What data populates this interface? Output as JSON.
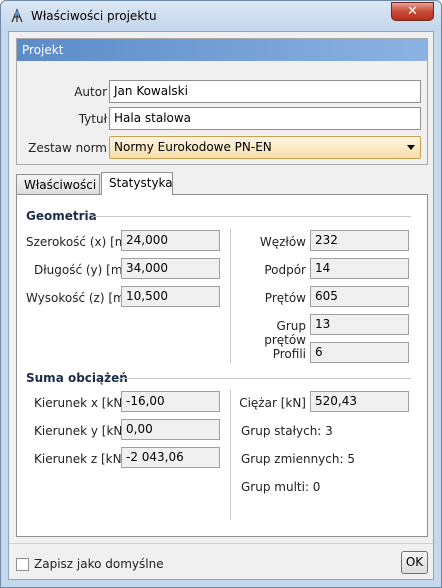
{
  "window": {
    "title": "Właściwości projektu",
    "close_label": "✕"
  },
  "project": {
    "header": "Projekt",
    "author_label": "Autor",
    "author_value": "Jan Kowalski",
    "title_label": "Tytuł",
    "title_value": "Hala stalowa",
    "norms_label": "Zestaw norm",
    "norms_value": "Normy Eurokodowe PN-EN"
  },
  "tabs": [
    {
      "label": "Właściwości"
    },
    {
      "label": "Statystyka"
    }
  ],
  "geometry": {
    "header": "Geometria",
    "width_label": "Szerokość (x) [m]",
    "width_value": "24,000",
    "length_label": "Długość (y) [m]",
    "length_value": "34,000",
    "height_label": "Wysokość (z) [m]",
    "height_value": "10,500",
    "nodes_label": "Węzłów",
    "nodes_value": "232",
    "supports_label": "Podpór",
    "supports_value": "14",
    "bars_label": "Prętów",
    "bars_value": "605",
    "bargroups_label": "Grup prętów",
    "bargroups_value": "13",
    "profiles_label": "Profili",
    "profiles_value": "6"
  },
  "loads": {
    "header": "Suma obciążeń",
    "dirx_label": "Kierunek x [kN]",
    "dirx_value": "-16,00",
    "diry_label": "Kierunek y [kN]",
    "diry_value": "0,00",
    "dirz_label": "Kierunek z [kN]",
    "dirz_value": "-2 043,06",
    "weight_label": "Ciężar [kN]",
    "weight_value": "520,43",
    "const_groups": "Grup stałych: 3",
    "var_groups": "Grup zmiennych: 5",
    "multi_groups": "Grup multi: 0"
  },
  "footer": {
    "save_default_label": "Zapisz jako domyślne",
    "ok_label": "OK"
  },
  "colors": {
    "title_bar": "#c3d6ec",
    "header_accent": "#5b8bc8",
    "close_button": "#c74a36",
    "combo_bg": "#f6dfa8"
  },
  "icons": {
    "app": "structure-icon",
    "close": "close-icon",
    "dropdown": "chevron-down-icon"
  }
}
